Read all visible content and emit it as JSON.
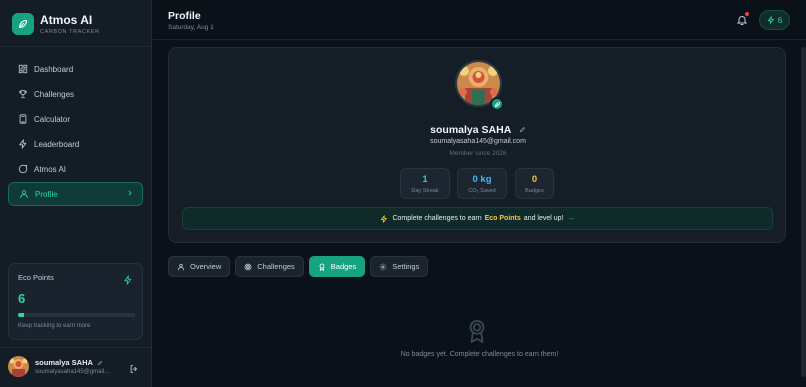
{
  "brand": {
    "title": "Atmos AI",
    "subtitle": "CARBON TRACKER"
  },
  "sidebar": {
    "items": [
      {
        "label": "Dashboard",
        "icon": "grid-icon"
      },
      {
        "label": "Challenges",
        "icon": "trophy-icon"
      },
      {
        "label": "Calculator",
        "icon": "calculator-icon"
      },
      {
        "label": "Leaderboard",
        "icon": "zap-icon"
      },
      {
        "label": "Atmos AI",
        "icon": "chat-icon"
      },
      {
        "label": "Profile",
        "icon": "user-icon",
        "active": true
      }
    ]
  },
  "eco": {
    "title": "Eco Points",
    "value": "6",
    "progress": 0.05,
    "hint": "Keep tracking to earn more"
  },
  "user": {
    "name": "soumalya SAHA",
    "email": "soumalyasaha145@gmail...."
  },
  "header": {
    "title": "Profile",
    "date": "Saturday, Aug 1",
    "points": "6"
  },
  "profile": {
    "name": "soumalya SAHA",
    "email": "soumalyasaha145@gmail.com",
    "since": "Member since 2026",
    "stats": [
      {
        "value": "1",
        "label": "Day Streak",
        "color": "#2fd3a5"
      },
      {
        "value": "0 kg",
        "label": "CO₂ Saved",
        "color": "#38bdf8"
      },
      {
        "value": "0",
        "label": "Badges",
        "color": "#f5c542"
      }
    ],
    "cta": {
      "prefix": "Complete challenges to earn",
      "highlight": "Eco Points",
      "suffix": "and level up!",
      "arrow": "→"
    }
  },
  "tabs": [
    {
      "label": "Overview",
      "icon": "user-icon"
    },
    {
      "label": "Challenges",
      "icon": "target-icon"
    },
    {
      "label": "Badges",
      "icon": "award-icon",
      "active": true
    },
    {
      "label": "Settings",
      "icon": "gear-icon"
    }
  ],
  "empty": {
    "text": "No badges yet. Complete challenges to earn them!"
  },
  "colors": {
    "accent": "#17a382",
    "accent_text": "#2fd3a5",
    "highlight": "#f5c542",
    "background": "#0b1119"
  }
}
